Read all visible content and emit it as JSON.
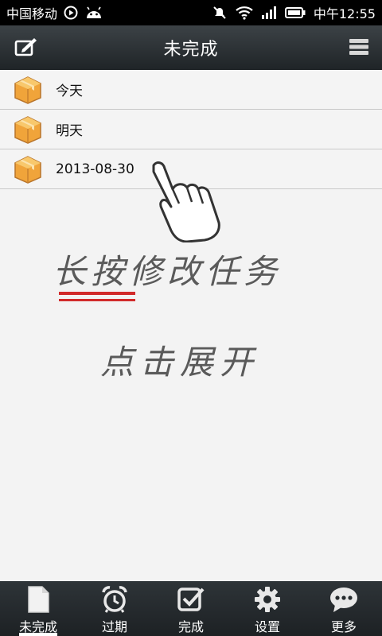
{
  "status_bar": {
    "carrier": "中国移动",
    "time": "中午12:55",
    "icons": [
      "play-icon",
      "android-icon",
      "mute-icon",
      "wifi-icon",
      "signal-icon",
      "battery-icon"
    ]
  },
  "title_bar": {
    "title": "未完成",
    "left_icon": "edit-icon",
    "right_icon": "menu-icon"
  },
  "list": {
    "items": [
      {
        "label": "今天",
        "icon": "box-icon"
      },
      {
        "label": "明天",
        "icon": "box-icon"
      },
      {
        "label": "2013-08-30",
        "icon": "box-icon"
      }
    ]
  },
  "hint": {
    "line1": "长按修改任务",
    "line2": "点击展开",
    "underline_color": "#d12a2a"
  },
  "bottom_nav": {
    "items": [
      {
        "label": "未完成",
        "icon": "document-icon",
        "active": true
      },
      {
        "label": "过期",
        "icon": "alarm-clock-icon",
        "active": false
      },
      {
        "label": "完成",
        "icon": "checkbox-icon",
        "active": false
      },
      {
        "label": "设置",
        "icon": "gear-icon",
        "active": false
      },
      {
        "label": "更多",
        "icon": "chat-bubble-icon",
        "active": false
      }
    ]
  },
  "colors": {
    "title_bar": "#2b3033",
    "background": "#f3f3f3",
    "box_orange": "#f0a43a"
  }
}
